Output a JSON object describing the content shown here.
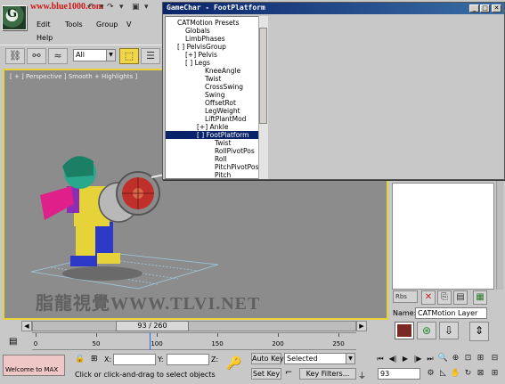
{
  "watermark_top": "www.blue1000.com",
  "watermark_center": "脂龍視覺WWW.TLVI.NET",
  "menu": {
    "edit": "Edit",
    "tools": "Tools",
    "group": "Group",
    "help": "Help"
  },
  "toolbar": {
    "selection_filter": "All"
  },
  "viewport": {
    "label": "[ + ] Perspective ] Smooth + Highlights ]"
  },
  "dialog": {
    "title": "GameChar - FootPlatform",
    "tree_items": [
      {
        "label": "CATMotion Presets",
        "indent": 0,
        "selected": false
      },
      {
        "label": "Globals",
        "indent": 1,
        "selected": false
      },
      {
        "label": "LimbPhases",
        "indent": 1,
        "selected": false
      },
      {
        "label": "[ ] PelvisGroup",
        "indent": 0,
        "selected": false
      },
      {
        "label": "[+] Pelvis",
        "indent": 1,
        "selected": false
      },
      {
        "label": "[ ] Legs",
        "indent": 1,
        "selected": false
      },
      {
        "label": "KneeAngle",
        "indent": 2,
        "selected": false
      },
      {
        "label": "Twist",
        "indent": 2,
        "selected": false
      },
      {
        "label": "CrossSwing",
        "indent": 2,
        "selected": false
      },
      {
        "label": "Swing",
        "indent": 2,
        "selected": false
      },
      {
        "label": "OffsetRot",
        "indent": 2,
        "selected": false
      },
      {
        "label": "LegWeight",
        "indent": 2,
        "selected": false
      },
      {
        "label": "LiftPlantMod",
        "indent": 2,
        "selected": false
      },
      {
        "label": "[+] Ankle",
        "indent": 1.5,
        "selected": false
      },
      {
        "label": "[ ] FootPlatform",
        "indent": 1.5,
        "selected": true
      },
      {
        "label": "Twist",
        "indent": 3,
        "selected": false
      },
      {
        "label": "RollPivotPos",
        "indent": 3,
        "selected": false
      },
      {
        "label": "Roll",
        "indent": 3,
        "selected": false
      },
      {
        "label": "PitchPivotPos",
        "indent": 3,
        "selected": false
      },
      {
        "label": "Pitch",
        "indent": 3,
        "selected": false
      }
    ]
  },
  "command_panel": {
    "rbs_label": "Rbs",
    "name_label": "Name:",
    "name_value": "CATMotion Layer",
    "layer_color": "#7a2a22"
  },
  "timeline": {
    "current_frame_display": "93 / 260",
    "ticks": [
      0,
      50,
      100,
      150,
      200,
      250
    ],
    "frame_max": 260,
    "current_frame": 93
  },
  "status": {
    "welcome_text": "Welcome to MAX",
    "x_label": "X:",
    "y_label": "Y:",
    "z_label": "Z:",
    "prompt": "Click or click-and-drag to select objects",
    "auto_key": "Auto Key",
    "set_key": "Set Key",
    "key_mode": "Selected",
    "key_filters": "Key Filters...",
    "frame_value": "93"
  }
}
